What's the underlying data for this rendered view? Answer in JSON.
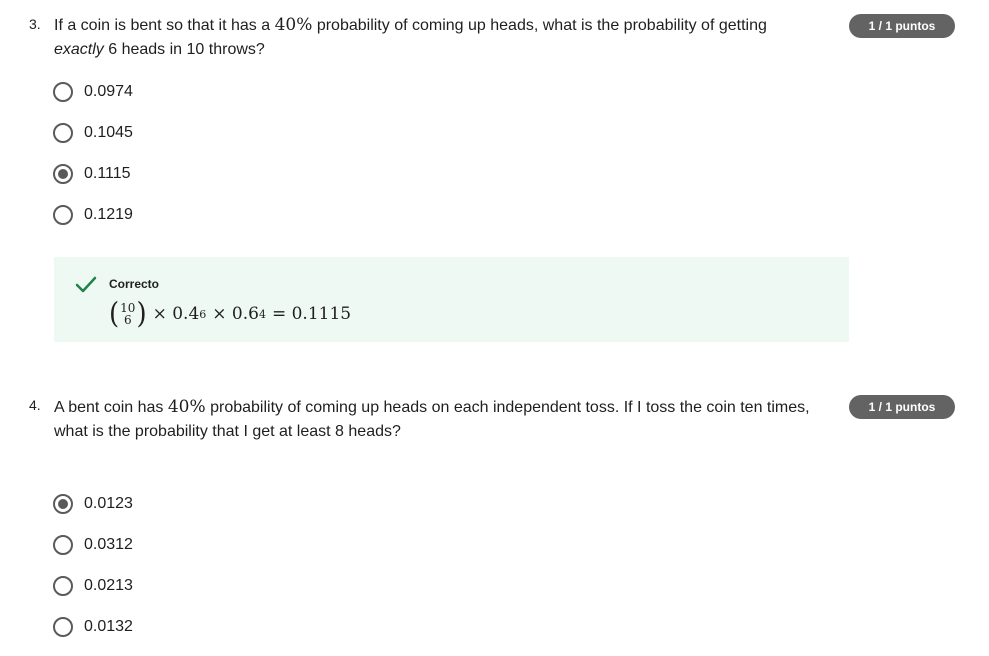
{
  "questions": [
    {
      "number": "3.",
      "text_part1": "If a coin is bent so that it has a ",
      "math_pct": "40%",
      "text_part2": " probability of coming up heads, what is the probability of getting",
      "text_line2_em": "exactly",
      "text_line2_rest": " 6 heads in 10 throws?",
      "badge": "1 / 1 puntos",
      "options": [
        {
          "label": "0.0974",
          "selected": false
        },
        {
          "label": "0.1045",
          "selected": false
        },
        {
          "label": "0.1115",
          "selected": true
        },
        {
          "label": "0.1219",
          "selected": false
        }
      ],
      "feedback": {
        "title": "Correcto",
        "binom_top": "10",
        "binom_bottom": "6",
        "formula_rest_1": "× 0.4",
        "exp1": "6",
        "formula_rest_2": "× 0.6",
        "exp2": "4",
        "formula_rest_3": "= 0.1115"
      }
    },
    {
      "number": "4.",
      "text_part1": "A bent coin has ",
      "math_pct": "40%",
      "text_part2": " probability of coming up heads on each independent toss. If I toss the coin ten times,",
      "text_line2_rest": "what is the probability that I get at least 8 heads?",
      "badge": "1 / 1 puntos",
      "options": [
        {
          "label": "0.0123",
          "selected": true
        },
        {
          "label": "0.0312",
          "selected": false
        },
        {
          "label": "0.0213",
          "selected": false
        },
        {
          "label": "0.0132",
          "selected": false
        }
      ]
    }
  ],
  "colors": {
    "badge_bg": "#636363",
    "feedback_bg": "#eef9f4",
    "check_green": "#1e8449",
    "radio": "#5a5a5a"
  }
}
